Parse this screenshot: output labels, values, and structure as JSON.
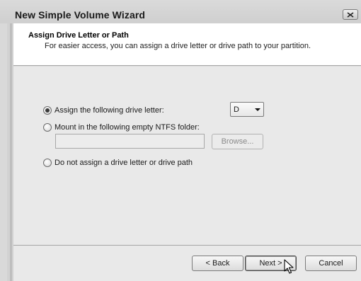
{
  "window": {
    "title": "New Simple Volume Wizard",
    "close_icon": "close-icon"
  },
  "header": {
    "title": "Assign Drive Letter or Path",
    "subtitle": "For easier access, you can assign a drive letter or drive path to your partition."
  },
  "options": {
    "assign_letter": {
      "label": "Assign the following drive letter:",
      "selected": true
    },
    "mount_folder": {
      "label": "Mount in the following empty NTFS folder:",
      "selected": false
    },
    "no_assign": {
      "label": "Do not assign a drive letter or drive path",
      "selected": false
    }
  },
  "drive_letter": {
    "value": "D"
  },
  "folder_path": {
    "value": ""
  },
  "buttons": {
    "browse": "Browse...",
    "back": "< Back",
    "next": "Next >",
    "cancel": "Cancel"
  },
  "icons": {
    "cursor": "mouse-pointer-icon"
  }
}
